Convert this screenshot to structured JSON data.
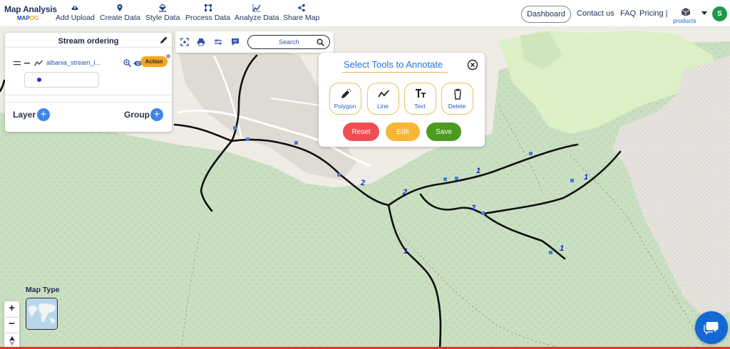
{
  "brand": {
    "name": "Map Analysis",
    "sub_main": "MAP",
    "sub_accent": "OG"
  },
  "nav": {
    "items": [
      {
        "label": "Add Upload",
        "icon": "cloud-upload-icon"
      },
      {
        "label": "Create Data",
        "icon": "location-pin-icon"
      },
      {
        "label": "Style Data",
        "icon": "paint-bucket-icon"
      },
      {
        "label": "Process Data",
        "icon": "process-nodes-icon"
      },
      {
        "label": "Analyze Data",
        "icon": "analyze-chart-icon"
      },
      {
        "label": "Share Map",
        "icon": "share-icon"
      }
    ],
    "dashboard": "Dashboard",
    "contact": "Contact us",
    "faq": "FAQ",
    "pricing": "Pricing |",
    "products": "products",
    "avatar_letter": "S"
  },
  "layer_panel": {
    "title": "Stream ordering",
    "layer": {
      "name": "albania_stream_l...",
      "action_label": "Action",
      "point_color": "#2c2cd6"
    },
    "footer": {
      "layer_label": "Layer",
      "group_label": "Group",
      "plus_symbol": "+"
    }
  },
  "toolbar": {
    "search_placeholder": "Search"
  },
  "annotation": {
    "title": "Select Tools to Annotate",
    "tools": [
      {
        "label": "Polygon",
        "icon": "polygon-pen-icon"
      },
      {
        "label": "Line",
        "icon": "polyline-icon"
      },
      {
        "label": "Text",
        "icon": "text-tool-icon"
      },
      {
        "label": "Delete",
        "icon": "trash-icon"
      }
    ],
    "actions": {
      "reset": "Reset",
      "edit": "Edit",
      "save": "Save"
    }
  },
  "map": {
    "map_type_label": "Map Type",
    "zoom_in": "+",
    "zoom_out": "−",
    "stream_order_labels": [
      "2",
      "2",
      "1",
      "1",
      "2",
      "1",
      "1"
    ],
    "colors": {
      "forest": "#c9dfc2",
      "open_land": "#f0ede6",
      "urban": "#dfdcd6",
      "meadow": "#dbf0c4",
      "scree": "#e7e4e0",
      "stream": "#101010",
      "order_label": "#1626c8"
    }
  },
  "colors": {
    "reset": "#ef4d55",
    "edit": "#f7b634",
    "save": "#4c9a1e",
    "accent": "#2d6fd6",
    "action": "#f5a623",
    "chat": "#1368d4"
  }
}
